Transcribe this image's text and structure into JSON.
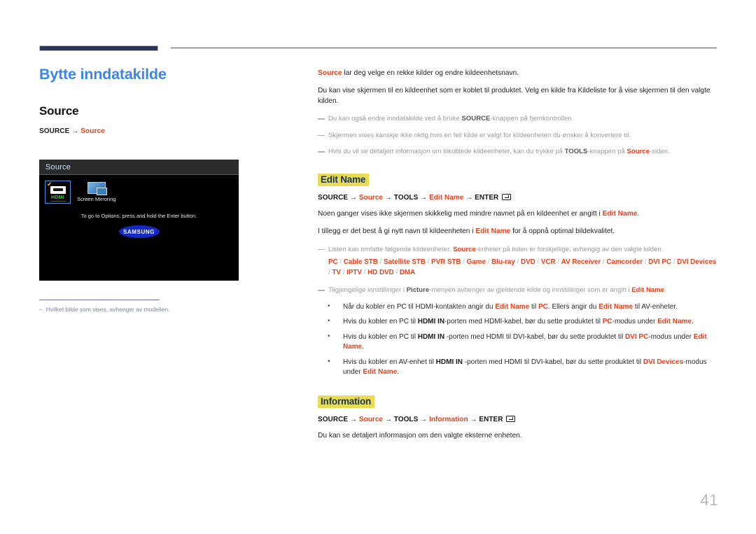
{
  "page": {
    "number": "41"
  },
  "left": {
    "doc_title": "Bytte inndatakilde",
    "section_title": "Source",
    "path": {
      "prefix": "SOURCE",
      "arrow": "→",
      "target": "Source"
    },
    "footnote": {
      "dash": "–",
      "text": "Hvilket bilde som vises, avhenger av modellen."
    }
  },
  "tv_screen": {
    "header_label": "Source",
    "sources": [
      {
        "label": "HDMI",
        "selected": true,
        "check": "✔",
        "icon": "hdmi-port-icon"
      },
      {
        "label": "Screen Mirroring",
        "selected": false,
        "icon": "screen-mirroring-icon"
      }
    ],
    "hint": "To go to Options, press and hold the Enter button.",
    "brand": "SAMSUNG"
  },
  "right": {
    "intro": {
      "lead": "Source",
      "rest": " lar deg velge en rekke kilder og endre kildeenhetsnavn."
    },
    "paragraph2": "Du kan vise skjermen til en kildeenhet som er koblet til produktet. Velg en kilde fra Kildeliste for å vise skjermen til den valgte kilden.",
    "notes_top": [
      {
        "pre": "Du kan også endre inndatakilde ved å bruke ",
        "bold": "SOURCE",
        "post": "-knappen på fjernkontrollen."
      },
      {
        "pre": "Skjermen vises kanskje ikke riktig hvis en feil kilde er valgt for kildeenheten du ønsker å konvertere til.",
        "bold": "",
        "post": ""
      },
      {
        "pre": "Hvis du vil se detaljert informasjon om tilkoblede kildeenheter, kan du trykke på ",
        "bold": "TOOLS",
        "post": "-knappen på ",
        "hl": "Source",
        "tail": "-siden."
      }
    ],
    "edit_name": {
      "heading": "Edit Name",
      "path": {
        "p1": "SOURCE",
        "p2": "Source",
        "p3": "TOOLS",
        "p4": "Edit Name",
        "p5": "ENTER",
        "arrow": "→"
      },
      "para1_pre": "Noen ganger vises ikke skjermen skikkelig med mindre navnet på en kildeenhet er angitt i ",
      "para1_hl": "Edit Name",
      "para1_post": ".",
      "para2_pre": "I tillegg er det best å gi nytt navn til kildeenheten i ",
      "para2_hl": "Edit Name",
      "para2_post": " for å oppnå optimal bildekvalitet.",
      "note_list_pre": "Listen kan omfatte følgende kildeenheter. ",
      "note_list_hl": "Source",
      "note_list_post": "-enheter på listen er forskjellige, avhengig av den valgte kilden.",
      "device_list": [
        "PC",
        "Cable STB",
        "Satellite STB",
        "PVR STB",
        "Game",
        "Blu-ray",
        "DVD",
        "VCR",
        "AV Receiver",
        "Camcorder",
        "DVI PC",
        "DVI Devices",
        "TV",
        "IPTV",
        "HD DVD",
        "DMA"
      ],
      "device_separator": "/",
      "note_picture_pre": "Tilgjengelige innstillinger i ",
      "note_picture_bold": "Picture",
      "note_picture_mid": "-menyen avhenger av gjeldende kilde og innstillinger som er angitt i ",
      "note_picture_hl": "Edit Name",
      "note_picture_post": ".",
      "bullets": [
        {
          "segments": [
            {
              "t": "Når du kobler en PC til HDMI-kontakten angir du ",
              "s": "n"
            },
            {
              "t": "Edit Name",
              "s": "hl"
            },
            {
              "t": " til ",
              "s": "n"
            },
            {
              "t": "PC",
              "s": "hl"
            },
            {
              "t": ". Ellers angir du ",
              "s": "n"
            },
            {
              "t": "Edit Name",
              "s": "hl"
            },
            {
              "t": " til AV-enheter.",
              "s": "n"
            }
          ]
        },
        {
          "segments": [
            {
              "t": "Hvis du kobler en PC til ",
              "s": "n"
            },
            {
              "t": "HDMI IN",
              "s": "bd"
            },
            {
              "t": "-porten med HDMI-kabel, bør du sette produktet til ",
              "s": "n"
            },
            {
              "t": "PC",
              "s": "hl"
            },
            {
              "t": "-modus under ",
              "s": "n"
            },
            {
              "t": "Edit Name",
              "s": "hl"
            },
            {
              "t": ".",
              "s": "n"
            }
          ]
        },
        {
          "segments": [
            {
              "t": "Hvis du kobler en PC til ",
              "s": "n"
            },
            {
              "t": "HDMI IN",
              "s": "bd"
            },
            {
              "t": " -porten med HDMI til DVI-kabel, bør du sette produktet til ",
              "s": "n"
            },
            {
              "t": "DVI PC",
              "s": "hl"
            },
            {
              "t": "-modus under ",
              "s": "n"
            },
            {
              "t": "Edit Name",
              "s": "hl"
            },
            {
              "t": ".",
              "s": "n"
            }
          ]
        },
        {
          "segments": [
            {
              "t": "Hvis du kobler en AV-enhet til ",
              "s": "n"
            },
            {
              "t": "HDMI IN",
              "s": "bd"
            },
            {
              "t": " -porten med HDMI til DVI-kabel, bør du sette produktet til ",
              "s": "n"
            },
            {
              "t": "DVI Devices",
              "s": "hl"
            },
            {
              "t": "-modus under ",
              "s": "n"
            },
            {
              "t": "Edit Name",
              "s": "hl"
            },
            {
              "t": ".",
              "s": "n"
            }
          ]
        }
      ]
    },
    "information": {
      "heading": "Information",
      "path": {
        "p1": "SOURCE",
        "p2": "Source",
        "p3": "TOOLS",
        "p4": "Information",
        "p5": "ENTER",
        "arrow": "→"
      },
      "paragraph": "Du kan se detaljert informasjon om den valgte eksterne enheten."
    }
  },
  "colors": {
    "accent_red": "#e8401c",
    "title_blue": "#3a86e8",
    "highlight_yellow": "#e8dc52",
    "rule_navy": "#2c3354"
  }
}
